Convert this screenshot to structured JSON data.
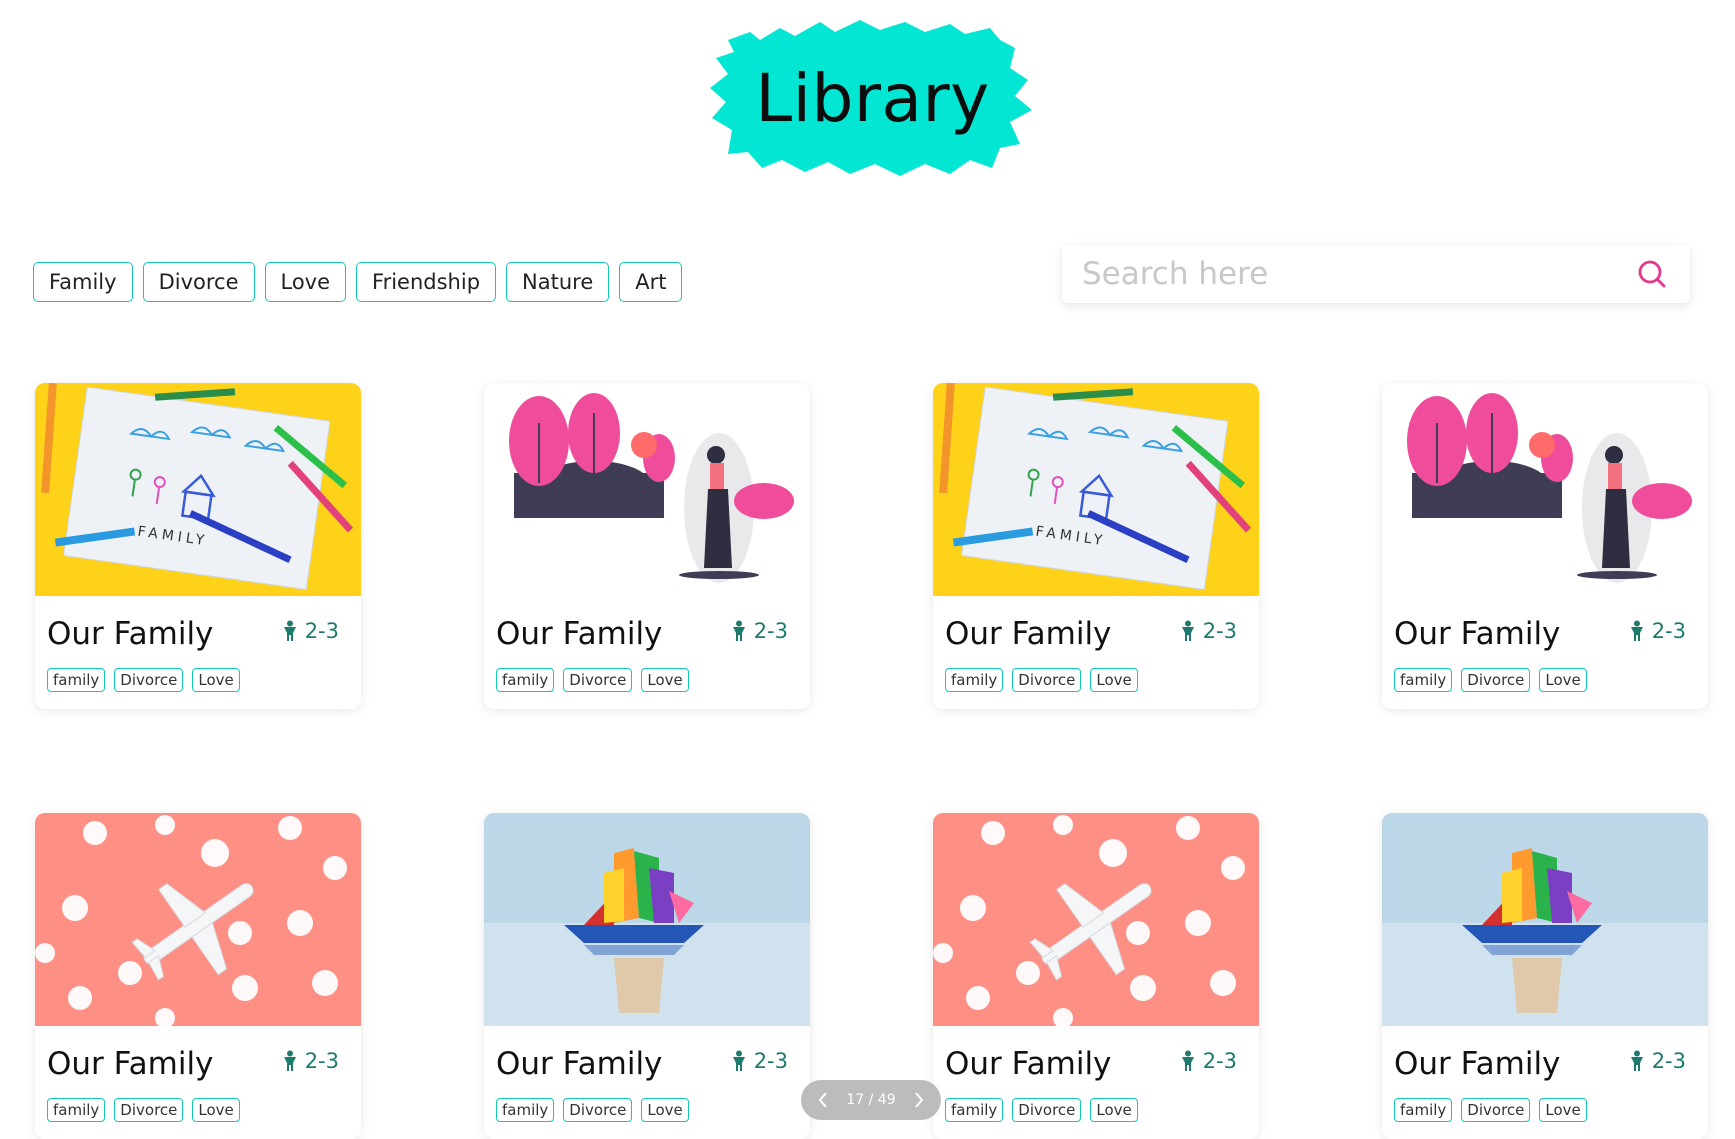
{
  "header": {
    "title": "Library",
    "accent": "#03e6d3"
  },
  "filters": [
    "Family",
    "Divorce",
    "Love",
    "Friendship",
    "Nature",
    "Art"
  ],
  "search": {
    "placeholder": "Search here",
    "value": "",
    "icon": "search-icon",
    "icon_color": "#e8358c"
  },
  "cards": [
    {
      "title": "Our Family",
      "age": "2-3",
      "image": "family-drawing-image",
      "tags": [
        "family",
        "Divorce",
        "Love"
      ]
    },
    {
      "title": "Our Family",
      "age": "2-3",
      "image": "woman-trees-illustration",
      "tags": [
        "family",
        "Divorce",
        "Love"
      ]
    },
    {
      "title": "Our Family",
      "age": "2-3",
      "image": "family-drawing-image",
      "tags": [
        "family",
        "Divorce",
        "Love"
      ]
    },
    {
      "title": "Our Family",
      "age": "2-3",
      "image": "woman-trees-illustration",
      "tags": [
        "family",
        "Divorce",
        "Love"
      ]
    },
    {
      "title": "Our Family",
      "age": "2-3",
      "image": "airplane-clouds-image",
      "tags": [
        "family",
        "Divorce",
        "Love"
      ]
    },
    {
      "title": "Our Family",
      "age": "2-3",
      "image": "paper-boat-image",
      "tags": [
        "family",
        "Divorce",
        "Love"
      ]
    },
    {
      "title": "Our Family",
      "age": "2-3",
      "image": "airplane-clouds-image",
      "tags": [
        "family",
        "Divorce",
        "Love"
      ]
    },
    {
      "title": "Our Family",
      "age": "2-3",
      "image": "paper-boat-image",
      "tags": [
        "family",
        "Divorce",
        "Love"
      ]
    }
  ],
  "pager": {
    "label": "17 / 49"
  },
  "colors": {
    "chip_border": "#14c8b8",
    "age_text": "#1d7a6d",
    "pink": "#e8358c"
  }
}
